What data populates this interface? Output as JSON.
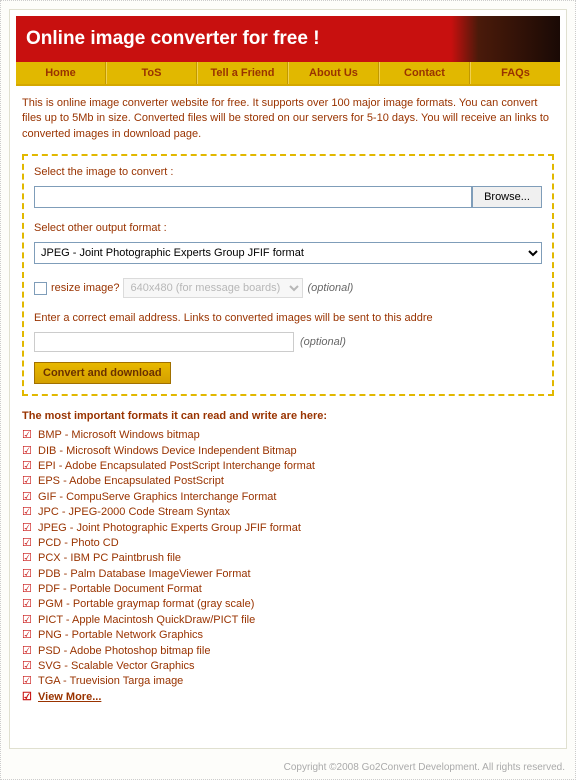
{
  "header": {
    "title": "Online image converter for free !"
  },
  "nav": [
    "Home",
    "ToS",
    "Tell a Friend",
    "About Us",
    "Contact",
    "FAQs"
  ],
  "intro": "This is online image converter website for free. It supports over 100 major image formats. You can convert files up to 5Mb in size. Converted files will be stored on our servers for 5-10 days. You will receive an links to converted images in download page.",
  "form": {
    "select_image_label": "Select the image to convert :",
    "browse_label": "Browse...",
    "output_format_label": "Select other output format :",
    "output_format_value": "JPEG - Joint Photographic Experts Group JFIF format",
    "resize_label": "resize image?",
    "resize_value": "640x480 (for message boards)",
    "optional": "(optional)",
    "email_label": "Enter a correct email address. Links to converted images will be sent to this addre",
    "convert_label": "Convert and download"
  },
  "formats": {
    "title": "The most important formats it can read and write are here:",
    "items": [
      "BMP - Microsoft Windows bitmap",
      "DIB - Microsoft Windows Device Independent Bitmap",
      "EPI - Adobe Encapsulated PostScript Interchange format",
      "EPS - Adobe Encapsulated PostScript",
      "GIF - CompuServe Graphics Interchange Format",
      "JPC - JPEG-2000 Code Stream Syntax",
      "JPEG - Joint Photographic Experts Group JFIF format",
      "PCD - Photo CD",
      "PCX - IBM PC Paintbrush file",
      "PDB - Palm Database ImageViewer Format",
      "PDF - Portable Document Format",
      "PGM - Portable graymap format (gray scale)",
      "PICT - Apple Macintosh QuickDraw/PICT file",
      "PNG - Portable Network Graphics",
      "PSD - Adobe Photoshop bitmap file",
      "SVG - Scalable Vector Graphics",
      "TGA - Truevision Targa image"
    ],
    "view_more": "View More..."
  },
  "footer": "Copyright ©2008 Go2Convert Development. All rights reserved."
}
